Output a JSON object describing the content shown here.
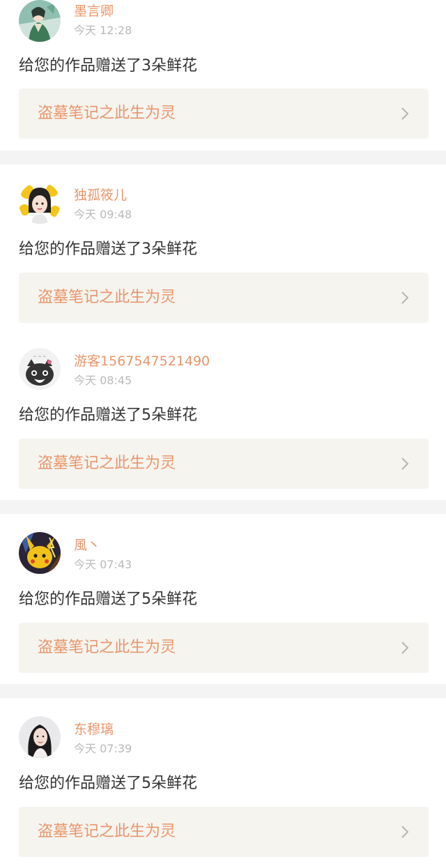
{
  "notifications": [
    {
      "username": "墨言卿",
      "time": "今天 12:28",
      "message": "给您的作品赠送了3朵鲜花",
      "work_title": "盗墓笔记之此生为灵",
      "avatar": "green-robed-character-avatar"
    },
    {
      "username": "独孤筱儿",
      "time": "今天 09:48",
      "message": "给您的作品赠送了3朵鲜花",
      "work_title": "盗墓笔记之此生为灵",
      "avatar": "cartoon-girl-yellow-flower-avatar"
    },
    {
      "username": "游客1567547521490",
      "time": "今天 08:45",
      "message": "给您的作品赠送了5朵鲜花",
      "work_title": "盗墓笔记之此生为灵",
      "avatar": "cartoon-cat-avatar"
    },
    {
      "username": "風丶",
      "time": "今天 07:43",
      "message": "给您的作品赠送了5朵鲜花",
      "work_title": "盗墓笔记之此生为灵",
      "avatar": "pikachu-lightning-avatar"
    },
    {
      "username": "东穆璃",
      "time": "今天 07:39",
      "message": "给您的作品赠送了5朵鲜花",
      "work_title": "盗墓笔记之此生为灵",
      "avatar": "girl-portrait-avatar"
    }
  ],
  "colors": {
    "accent": "#e8956a",
    "card_background": "#f5f4ef",
    "separator": "#f4f4f4",
    "timestamp": "#b9b9b9",
    "body_text": "#333333"
  },
  "icons": {
    "card_arrow": "chevron-right-icon"
  }
}
